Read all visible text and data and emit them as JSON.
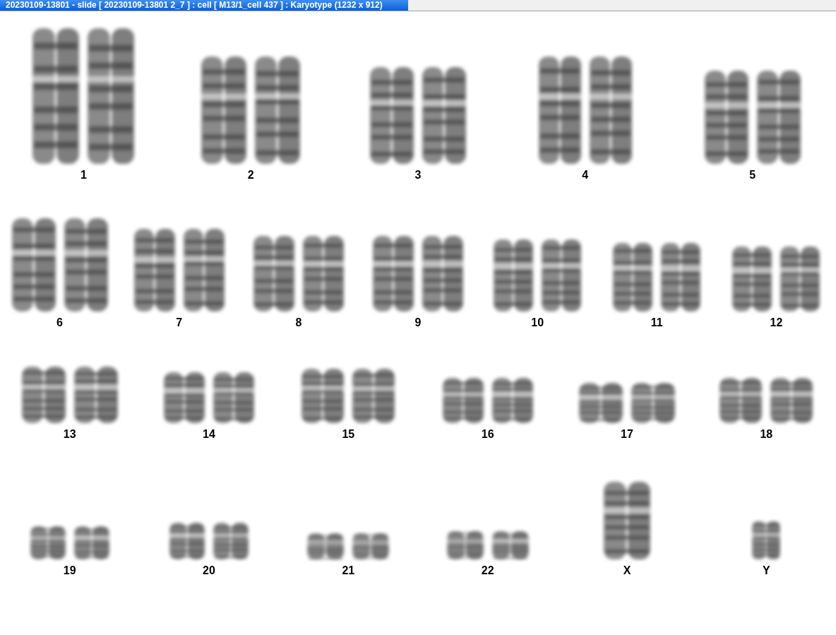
{
  "window": {
    "title": "20230109-13801 - slide [ 20230109-13801 2_7 ] : cell [ M13/1_cell 437 ] : Karyotype  (1232 x 912)"
  },
  "karyotype": {
    "rows": [
      {
        "groups": [
          {
            "label": "1",
            "kind": "pair"
          },
          {
            "label": "2",
            "kind": "pair"
          },
          {
            "label": "3",
            "kind": "pair"
          },
          {
            "label": "4",
            "kind": "pair"
          },
          {
            "label": "5",
            "kind": "pair"
          }
        ]
      },
      {
        "groups": [
          {
            "label": "6",
            "kind": "pair"
          },
          {
            "label": "7",
            "kind": "pair"
          },
          {
            "label": "8",
            "kind": "pair"
          },
          {
            "label": "9",
            "kind": "pair"
          },
          {
            "label": "10",
            "kind": "pair"
          },
          {
            "label": "11",
            "kind": "pair"
          },
          {
            "label": "12",
            "kind": "pair"
          }
        ]
      },
      {
        "groups": [
          {
            "label": "13",
            "kind": "pair"
          },
          {
            "label": "14",
            "kind": "pair"
          },
          {
            "label": "15",
            "kind": "pair"
          },
          {
            "label": "16",
            "kind": "pair"
          },
          {
            "label": "17",
            "kind": "pair"
          },
          {
            "label": "18",
            "kind": "pair"
          }
        ]
      },
      {
        "groups": [
          {
            "label": "19",
            "kind": "pair"
          },
          {
            "label": "20",
            "kind": "pair"
          },
          {
            "label": "21",
            "kind": "pair"
          },
          {
            "label": "22",
            "kind": "pair"
          },
          {
            "label": "X",
            "kind": "single"
          },
          {
            "label": "Y",
            "kind": "single"
          }
        ]
      }
    ]
  }
}
